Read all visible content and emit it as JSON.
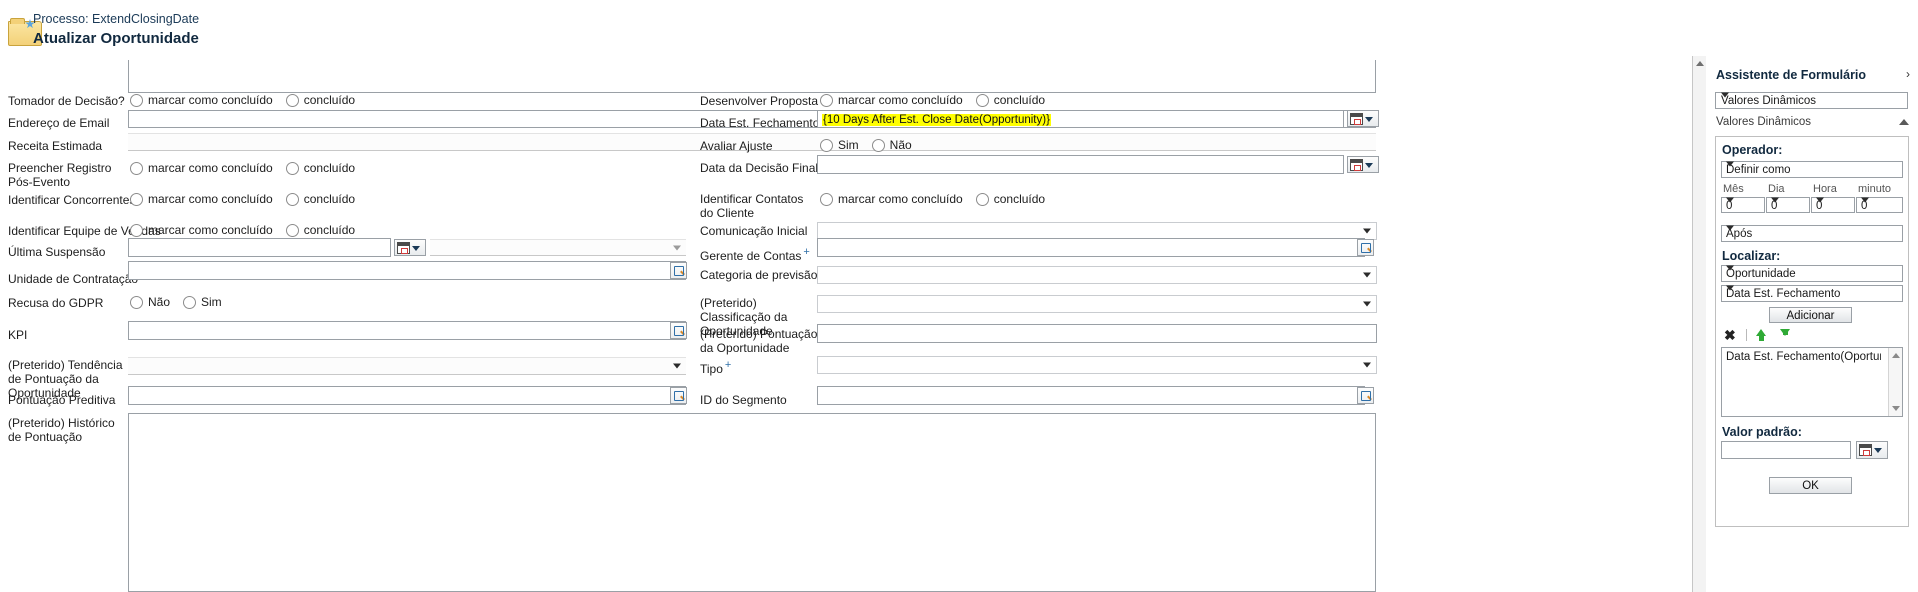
{
  "header": {
    "process_label": "Processo: ExtendClosingDate",
    "title": "Atualizar Oportunidade",
    "folder_icon": "folder-icon"
  },
  "form": {
    "left_column": [
      {
        "label": "Tomador de Decisão?",
        "type": "radio",
        "options": [
          "marcar como concluído",
          "concluído"
        ]
      },
      {
        "label": "Endereço de Email",
        "type": "text",
        "value": ""
      },
      {
        "label": "Receita Estimada",
        "type": "text",
        "value": ""
      },
      {
        "label": "Preencher Registro Pós-Evento",
        "type": "radio",
        "options": [
          "marcar como concluído",
          "concluído"
        ]
      },
      {
        "label": "Identificar Concorrentes",
        "type": "radio",
        "options": [
          "marcar como concluído",
          "concluído"
        ]
      },
      {
        "label": "Identificar Equipe de Vendas",
        "type": "radio",
        "options": [
          "marcar como concluído",
          "concluído"
        ]
      },
      {
        "label": "Última Suspensão",
        "type": "datetime",
        "value": ""
      },
      {
        "label": "Unidade de Contratação",
        "required": true,
        "type": "lookup",
        "value": ""
      },
      {
        "label": "Recusa do GDPR",
        "type": "radio",
        "options": [
          "Não",
          "Sim"
        ]
      },
      {
        "label": "KPI",
        "type": "lookup",
        "value": ""
      },
      {
        "label": "(Preterido) Tendência de Pontuação da Oportunidade",
        "type": "select",
        "value": ""
      },
      {
        "label": "Pontuação Preditiva",
        "type": "lookup",
        "value": ""
      },
      {
        "label": "(Preterido) Histórico de Pontuação",
        "type": "textarea",
        "value": ""
      }
    ],
    "right_column": [
      {
        "label": "Desenvolver Proposta",
        "type": "radio",
        "options": [
          "marcar como concluído",
          "concluído"
        ]
      },
      {
        "label": "Data Est. Fechamento",
        "type": "datetime",
        "value": "{10 Days After Est. Close Date(Opportunity)}",
        "highlighted": true
      },
      {
        "label": "Avaliar Ajuste",
        "type": "radio",
        "options": [
          "Sim",
          "Não"
        ]
      },
      {
        "label": "Data da Decisão Final",
        "type": "datetime",
        "value": ""
      },
      {
        "label": "Identificar Contatos do Cliente",
        "type": "radio",
        "options": [
          "marcar como concluído",
          "concluído"
        ]
      },
      {
        "label": "Comunicação Inicial",
        "type": "select",
        "value": ""
      },
      {
        "label": "Gerente de Contas",
        "required": true,
        "type": "lookup",
        "value": ""
      },
      {
        "label": "Categoria de previsão",
        "type": "select",
        "value": ""
      },
      {
        "label": "(Preterido) Classificação da Oportunidade",
        "type": "select",
        "value": ""
      },
      {
        "label": "(Preterido) Pontuação da Oportunidade",
        "type": "text",
        "value": ""
      },
      {
        "label": "Tipo",
        "required": true,
        "type": "select",
        "value": ""
      },
      {
        "label": "ID do Segmento",
        "type": "lookup",
        "value": ""
      }
    ]
  },
  "sidebar": {
    "title": "Assistente de Formulário",
    "collapse_icon": "chevron-right-icon",
    "selector_value": "Valores Dinâmicos",
    "section_label": "Valores Dinâmicos",
    "section_collapse_icon": "chevron-up-icon",
    "operator_heading": "Operador:",
    "operator_value": "Definir como",
    "time_fields": [
      {
        "label": "Mês",
        "value": "0"
      },
      {
        "label": "Dia",
        "value": "0"
      },
      {
        "label": "Hora",
        "value": "0"
      },
      {
        "label": "minuto",
        "value": "0"
      }
    ],
    "relation_value": "Após",
    "locate_heading": "Localizar:",
    "entity_value": "Oportunidade",
    "field_value": "Data Est. Fechamento",
    "add_button": "Adicionar",
    "toolbar": {
      "remove_icon": "close-x-icon",
      "move_up_icon": "arrow-up-icon",
      "move_down_icon": "arrow-down-icon",
      "arrow_color": "#2faa35"
    },
    "list_items": [
      "Data Est. Fechamento(Oportunidad"
    ],
    "default_heading": "Valor padrão:",
    "default_value": "",
    "calendar_icon": "calendar-icon",
    "ok_button": "OK"
  },
  "colors": {
    "highlight": "#ffff00",
    "required_marker": "#2f6fa8",
    "title": "#11293f"
  }
}
